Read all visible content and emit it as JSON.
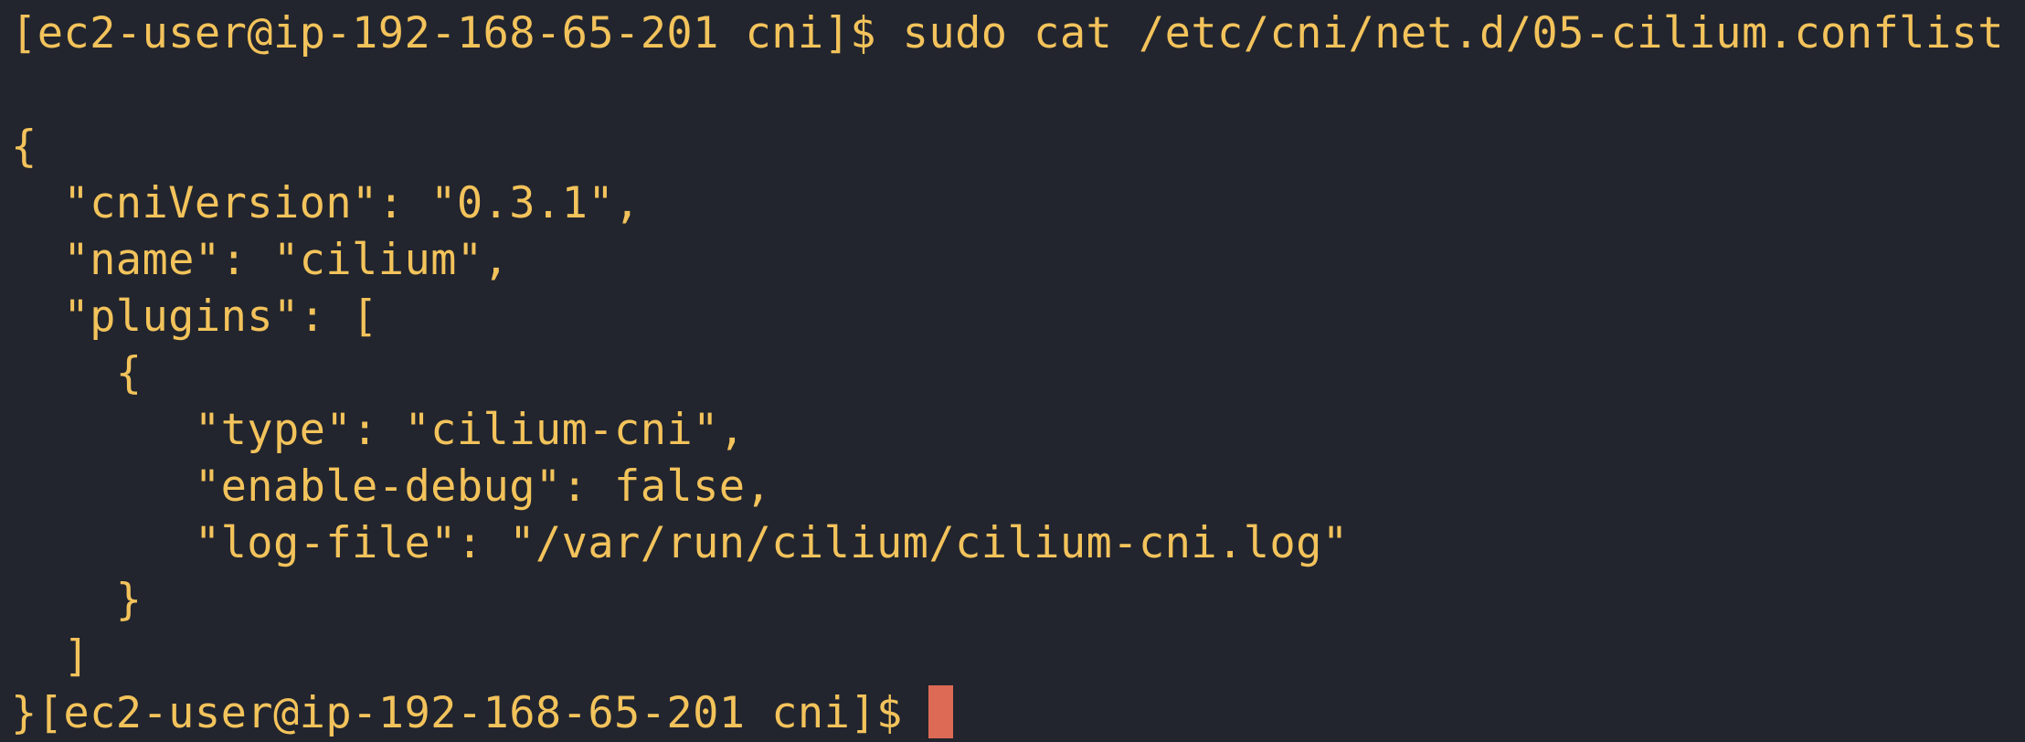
{
  "terminal": {
    "lines": [
      "[ec2-user@ip-192-168-65-201 cni]$ sudo cat /etc/cni/net.d/05-cilium.conflist",
      "",
      "{",
      "  \"cniVersion\": \"0.3.1\",",
      "  \"name\": \"cilium\",",
      "  \"plugins\": [",
      "    {",
      "       \"type\": \"cilium-cni\",",
      "       \"enable-debug\": false,",
      "       \"log-file\": \"/var/run/cilium/cilium-cni.log\"",
      "    }",
      "  ]",
      "}[ec2-user@ip-192-168-65-201 cni]$ "
    ],
    "colors": {
      "background": "#22252e",
      "text": "#f3c35b",
      "cursor": "#dd6a55"
    }
  }
}
